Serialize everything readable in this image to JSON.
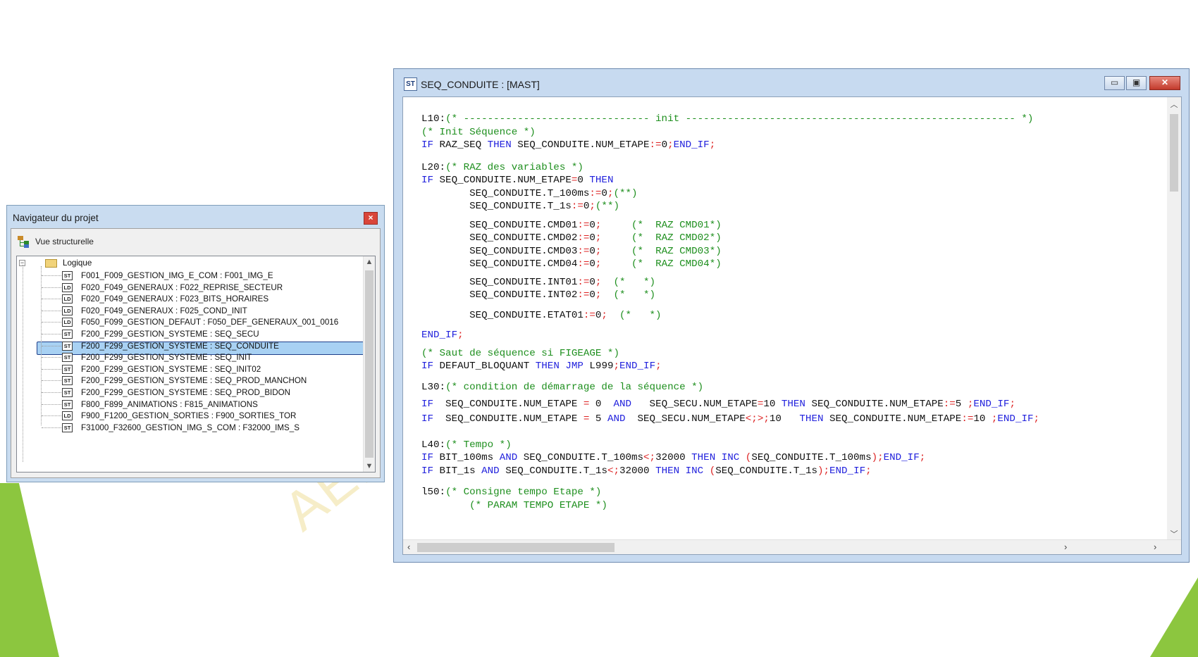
{
  "colors": {
    "accent_green": "#8cc63f",
    "keyword": "#2222dd",
    "comment": "#1e8f1e",
    "operator": "#dd2222",
    "selection": "#a8d1f3"
  },
  "watermark": "AEI",
  "navigator": {
    "title": "Navigateur du projet",
    "close_label": "×",
    "view_label": "Vue structurelle",
    "root": "Logique",
    "items": [
      {
        "badge": "ST",
        "label": "F001_F009_GESTION_IMG_E_COM : F001_IMG_E"
      },
      {
        "badge": "LD",
        "label": "F020_F049_GENERAUX : F022_REPRISE_SECTEUR"
      },
      {
        "badge": "LD",
        "label": "F020_F049_GENERAUX : F023_BITS_HORAIRES"
      },
      {
        "badge": "LD",
        "label": "F020_F049_GENERAUX : F025_COND_INIT"
      },
      {
        "badge": "LD",
        "label": "F050_F099_GESTION_DEFAUT : F050_DEF_GENERAUX_001_0016"
      },
      {
        "badge": "ST",
        "label": "F200_F299_GESTION_SYSTEME : SEQ_SECU"
      },
      {
        "badge": "ST",
        "label": "F200_F299_GESTION_SYSTEME : SEQ_CONDUITE",
        "selected": true
      },
      {
        "badge": "ST",
        "label": "F200_F299_GESTION_SYSTEME : SEQ_INIT"
      },
      {
        "badge": "ST",
        "label": "F200_F299_GESTION_SYSTEME : SEQ_INIT02"
      },
      {
        "badge": "ST",
        "label": "F200_F299_GESTION_SYSTEME : SEQ_PROD_MANCHON"
      },
      {
        "badge": "ST",
        "label": "F200_F299_GESTION_SYSTEME : SEQ_PROD_BIDON"
      },
      {
        "badge": "ST",
        "label": "F800_F899_ANIMATIONS : F815_ANIMATIONS"
      },
      {
        "badge": "LD",
        "label": "F900_F1200_GESTION_SORTIES : F900_SORTIES_TOR"
      },
      {
        "badge": "ST",
        "label": "F31000_F32600_GESTION_IMG_S_COM : F32000_IMS_S"
      }
    ]
  },
  "editor": {
    "icon_label": "ST",
    "title": "SEQ_CONDUITE : [MAST]",
    "buttons": {
      "minimize": "▭",
      "maximize": "▣",
      "close": "✕"
    },
    "lines": [
      "L10:(* ------------------------------- init ------------------------------------------------------- *)",
      "(* Init Séquence *)",
      "IF RAZ_SEQ THEN SEQ_CONDUITE.NUM_ETAPE:=0;END_IF;",
      "L20:(* RAZ des variables *)",
      "IF SEQ_CONDUITE.NUM_ETAPE=0 THEN",
      "        SEQ_CONDUITE.T_100ms:=0;(**)",
      "        SEQ_CONDUITE.T_1s:=0;(**)",
      "        SEQ_CONDUITE.CMD01:=0;     (*  RAZ CMD01*)",
      "        SEQ_CONDUITE.CMD02:=0;     (*  RAZ CMD02*)",
      "        SEQ_CONDUITE.CMD03:=0;     (*  RAZ CMD03*)",
      "        SEQ_CONDUITE.CMD04:=0;     (*  RAZ CMD04*)",
      "        SEQ_CONDUITE.INT01:=0;  (*   *)",
      "        SEQ_CONDUITE.INT02:=0;  (*   *)",
      "        SEQ_CONDUITE.ETAT01:=0;  (*   *)",
      "END_IF;",
      "(* Saut de séquence si FIGEAGE *)",
      "IF DEFAUT_BLOQUANT THEN JMP L999;END_IF;",
      "L30:(* condition de démarrage de la séquence *)",
      "IF  SEQ_CONDUITE.NUM_ETAPE = 0  AND   SEQ_SECU.NUM_ETAPE=10 THEN SEQ_CONDUITE.NUM_ETAPE:=5 ;END_IF;",
      "IF  SEQ_CONDUITE.NUM_ETAPE = 5 AND  SEQ_SECU.NUM_ETAPE<>10   THEN SEQ_CONDUITE.NUM_ETAPE:=10 ;END_IF;",
      "L40:(* Tempo *)",
      "IF BIT_100ms AND SEQ_CONDUITE.T_100ms<32000 THEN INC (SEQ_CONDUITE.T_100ms);END_IF;",
      "IF BIT_1s AND SEQ_CONDUITE.T_1s<32000 THEN INC (SEQ_CONDUITE.T_1s);END_IF;",
      "l50:(* Consigne tempo Etape *)",
      "        (* PARAM TEMPO ETAPE *)"
    ]
  }
}
